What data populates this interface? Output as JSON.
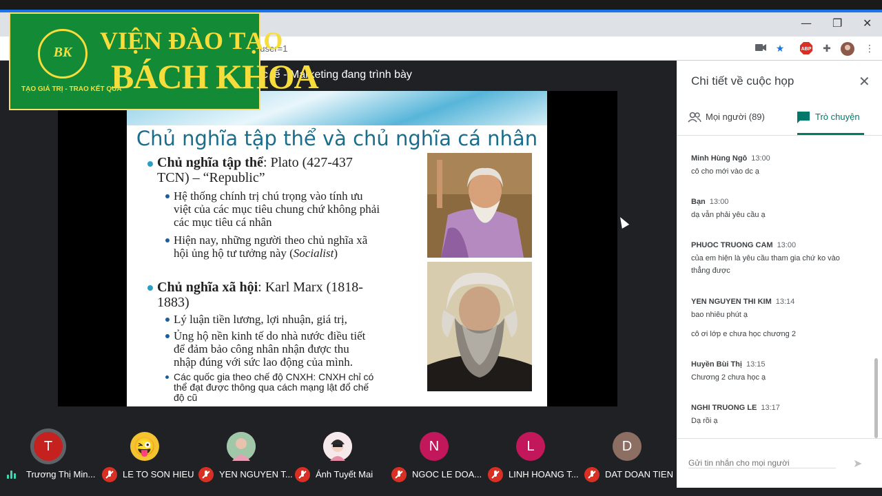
{
  "browser": {
    "url_fragment": "huser=1",
    "window_controls": [
      "—",
      "❐",
      "✕"
    ]
  },
  "logo": {
    "monogram": "BK",
    "line1": "VIỆN ĐÀO TẠO",
    "line2": "BÁCH KHOA",
    "slogan": "TẠO GIÁ TRỊ - TRAO KẾT QUẢ"
  },
  "presentation": {
    "presenter_text": "ốc tế - Marketing đang trình bày",
    "slide": {
      "title": "Chủ nghĩa tập thể và chủ nghĩa cá nhân",
      "bullet1_bold": "Chủ nghĩa tập thể",
      "bullet1_rest": ": Plato (427-437",
      "bullet1_line2": "TCN) – “Republic”",
      "sub1a": "Hệ thống chính trị chú trọng vào tính ưu",
      "sub1a_l2": "việt của các mục tiêu chung chứ không phải",
      "sub1a_l3": "các mục tiêu cá nhân",
      "sub1b": "Hiện nay, những người theo chủ nghĩa xã",
      "sub1b_l2a": "hội ủng hộ tư tưởng này (",
      "sub1b_l2b": "Socialist",
      "sub1b_l2c": ")",
      "bullet2_bold": "Chủ nghĩa xã hội",
      "bullet2_rest": ": Karl Marx (1818-",
      "bullet2_line2": "1883)",
      "sub2a": "Lý luận tiền lương, lợi nhuận, giá trị,",
      "sub2b": "Ủng hộ nền kinh tế do nhà nước điều tiết",
      "sub2b_l2": "để đảm bảo công nhân nhận được thu",
      "sub2b_l3": "nhập đúng với sức lao động của mình.",
      "sub2c": "Các quốc gia theo chế độ CNXH: CNXH chỉ có",
      "sub2c_l2": "thể đạt được thông qua  cách mạng lật đổ chế",
      "sub2c_l3": "độ cũ"
    }
  },
  "participants": [
    {
      "initial": "T",
      "name": "Trương Thị Min...",
      "color": "#c5221f",
      "muted": false
    },
    {
      "initial": "😜",
      "name": "LE TO SON HIEU",
      "color": "#f4c430",
      "muted": true
    },
    {
      "initial": "",
      "name": "YEN NGUYEN T...",
      "color": "#8ab4a0",
      "muted": true
    },
    {
      "initial": "",
      "name": "Ánh Tuyết Mai",
      "color": "#f1e3e6",
      "muted": true
    },
    {
      "initial": "N",
      "name": "NGOC LE DOA...",
      "color": "#c2185b",
      "muted": true
    },
    {
      "initial": "L",
      "name": "LINH HOANG T...",
      "color": "#c2185b",
      "muted": true
    },
    {
      "initial": "D",
      "name": "DAT DOAN TIEN",
      "color": "#8d6e63",
      "muted": true
    }
  ],
  "panel": {
    "title": "Chi tiết về cuộc họp",
    "tab_people": "Mọi người (89)",
    "tab_chat": "Trò chuyện",
    "messages": [
      {
        "sender": "Minh Hùng Ngô",
        "time": "13:00",
        "lines": [
          "cô cho mới vào dc ạ"
        ]
      },
      {
        "sender": "Bạn",
        "time": "13:00",
        "lines": [
          "dạ vẫn phải yêu cầu ạ"
        ]
      },
      {
        "sender": "PHUOC TRUONG CAM",
        "time": "13:00",
        "lines": [
          "của em hiện là yêu cầu tham gia chứ ko vào",
          "thẳng được"
        ]
      },
      {
        "sender": "YEN NGUYEN THI KIM",
        "time": "13:14",
        "lines": [
          "bao nhiêu phút ạ",
          "",
          "cô ơi lớp e chưa học chương 2"
        ]
      },
      {
        "sender": "Huyền Bùi Thị",
        "time": "13:15",
        "lines": [
          "Chương 2 chưa học ạ"
        ]
      },
      {
        "sender": "NGHI TRUONG LE",
        "time": "13:17",
        "lines": [
          "Dạ rồi ạ"
        ]
      }
    ],
    "input_placeholder": "Gửi tin nhắn cho mọi người"
  }
}
